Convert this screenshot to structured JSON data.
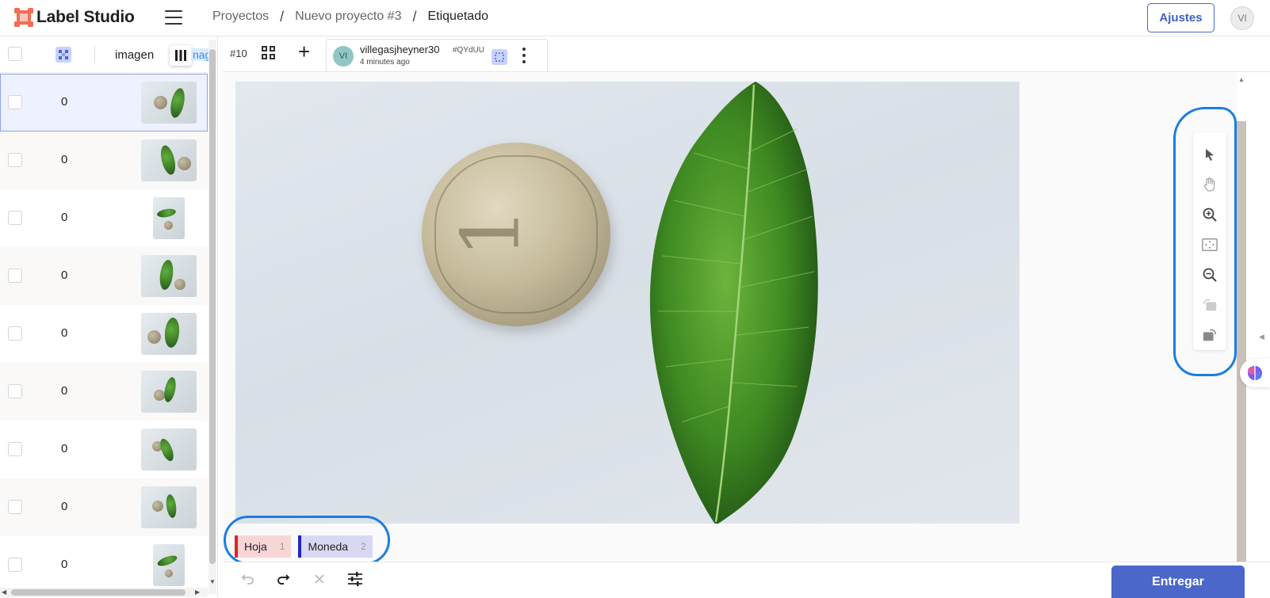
{
  "app": {
    "name": "Label Studio"
  },
  "breadcrumb": {
    "items": [
      "Proyectos",
      "Nuevo proyecto #3",
      "Etiquetado"
    ],
    "separator": "/"
  },
  "header": {
    "settings_label": "Ajustes",
    "user_initials": "VI"
  },
  "task_list": {
    "column_header": "imagen",
    "column_header_clipped": "nag",
    "rows": [
      {
        "value": "0"
      },
      {
        "value": "0"
      },
      {
        "value": "0"
      },
      {
        "value": "0"
      },
      {
        "value": "0"
      },
      {
        "value": "0"
      },
      {
        "value": "0"
      },
      {
        "value": "0"
      },
      {
        "value": "0"
      }
    ]
  },
  "annotation": {
    "task_id": "#10",
    "user_initials": "VI",
    "username": "villegasjheyner30",
    "time": "4 minutes ago",
    "hash": "#QYdUU"
  },
  "labels": [
    {
      "name": "Hoja",
      "hotkey": "1",
      "color": "#e02525"
    },
    {
      "name": "Moneda",
      "hotkey": "2",
      "color": "#2323c8"
    }
  ],
  "toolbar": {
    "tools": [
      "cursor-icon",
      "hand-icon",
      "zoom-in-icon",
      "fit-icon",
      "zoom-out-icon",
      "rotate-left-icon",
      "rotate-right-icon"
    ]
  },
  "footer": {
    "submit_label": "Entregar"
  },
  "colors": {
    "accent": "#4a67c9",
    "highlight": "#1a7de0"
  }
}
